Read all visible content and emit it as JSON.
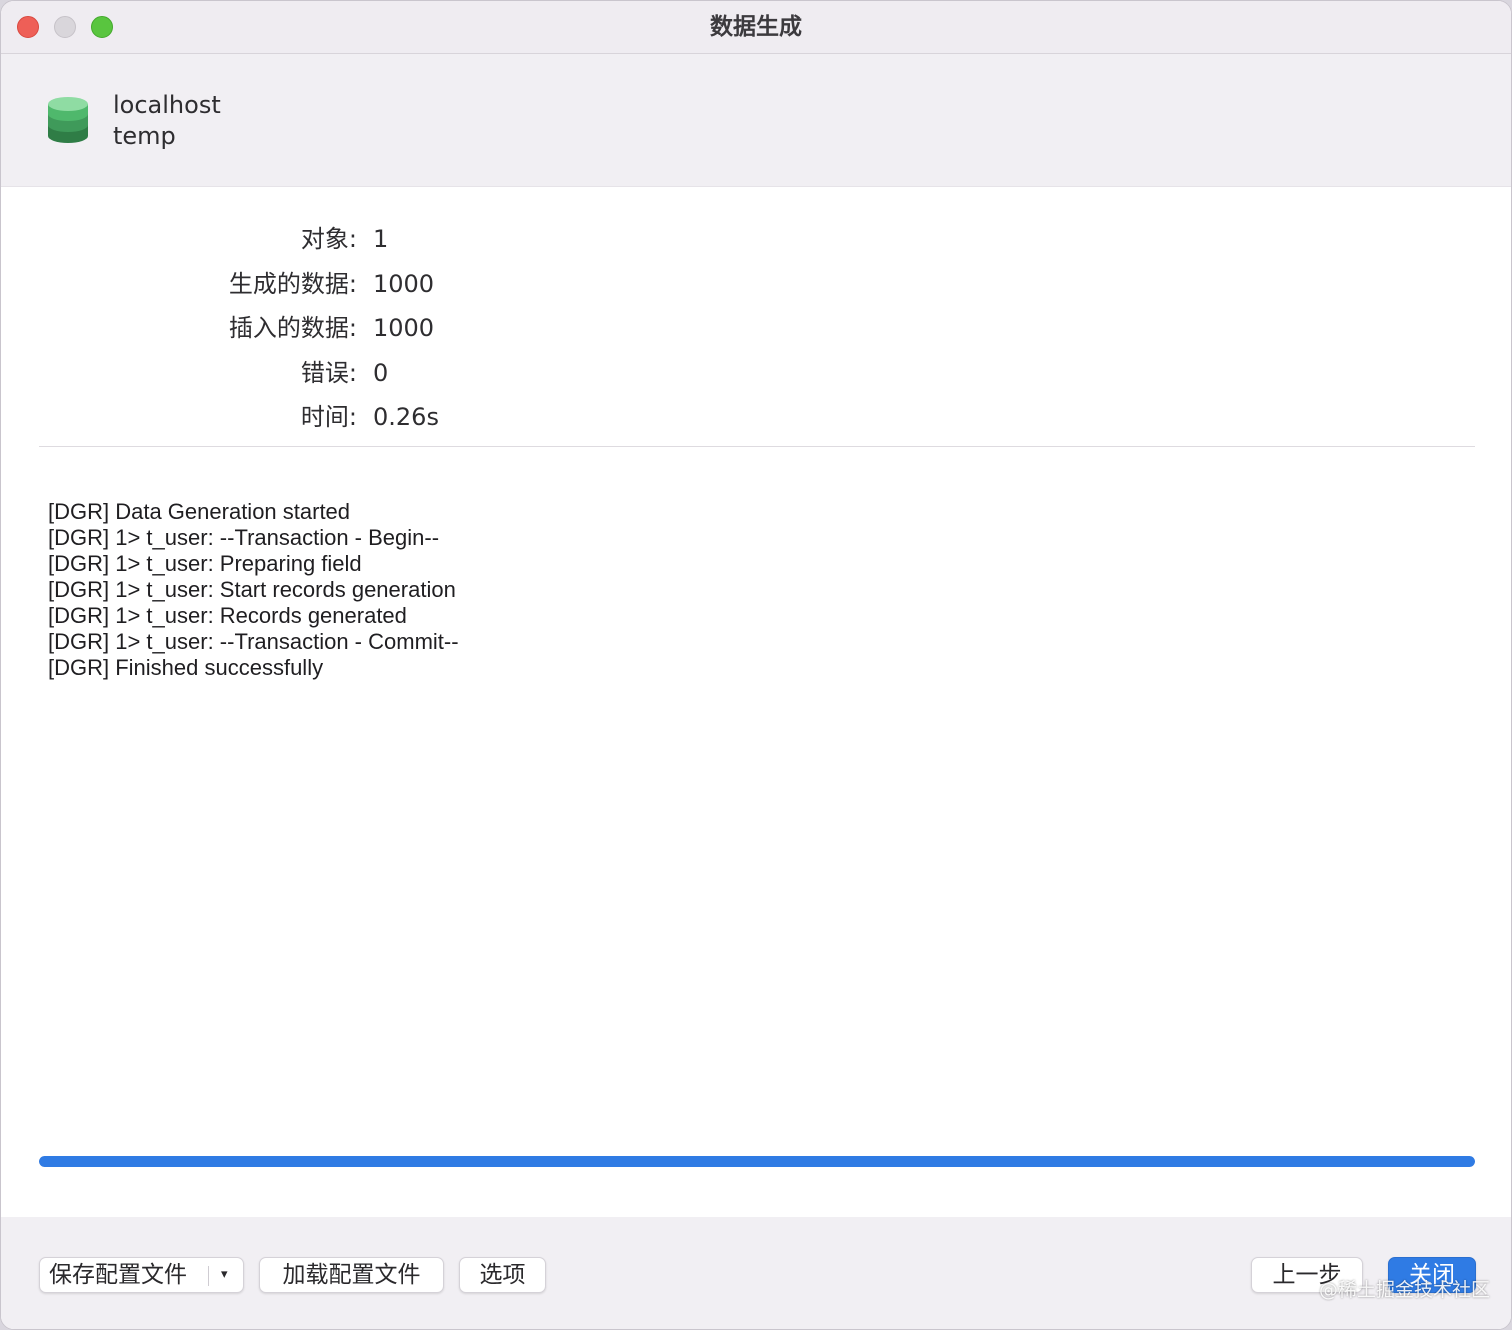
{
  "window": {
    "title": "数据生成"
  },
  "connection": {
    "host": "localhost",
    "database": "temp",
    "icon": "database-icon"
  },
  "stats": [
    {
      "label": "对象:",
      "value": "1"
    },
    {
      "label": "生成的数据:",
      "value": "1000"
    },
    {
      "label": "插入的数据:",
      "value": "1000"
    },
    {
      "label": "错误:",
      "value": "0"
    },
    {
      "label": "时间:",
      "value": "0.26s"
    }
  ],
  "log": [
    "[DGR] Data Generation started",
    "[DGR] 1> t_user: --Transaction - Begin--",
    "[DGR] 1> t_user: Preparing field",
    "[DGR] 1> t_user: Start records generation",
    "[DGR] 1> t_user: Records generated",
    "[DGR] 1> t_user: --Transaction - Commit--",
    "[DGR] Finished successfully"
  ],
  "progress": {
    "percent": 100
  },
  "footer": {
    "save_profile": "保存配置文件",
    "save_caret": "▾",
    "load_profile": "加载配置文件",
    "options": "选项",
    "previous": "上一步",
    "close": "关闭"
  },
  "watermark": "@稀土掘金技术社区",
  "colors": {
    "accent": "#2f7be4",
    "close_light": "#ee5f57",
    "minimize_light": "#d9d6db",
    "maximize_light": "#59c53f",
    "db_icon": "#3aa660"
  }
}
